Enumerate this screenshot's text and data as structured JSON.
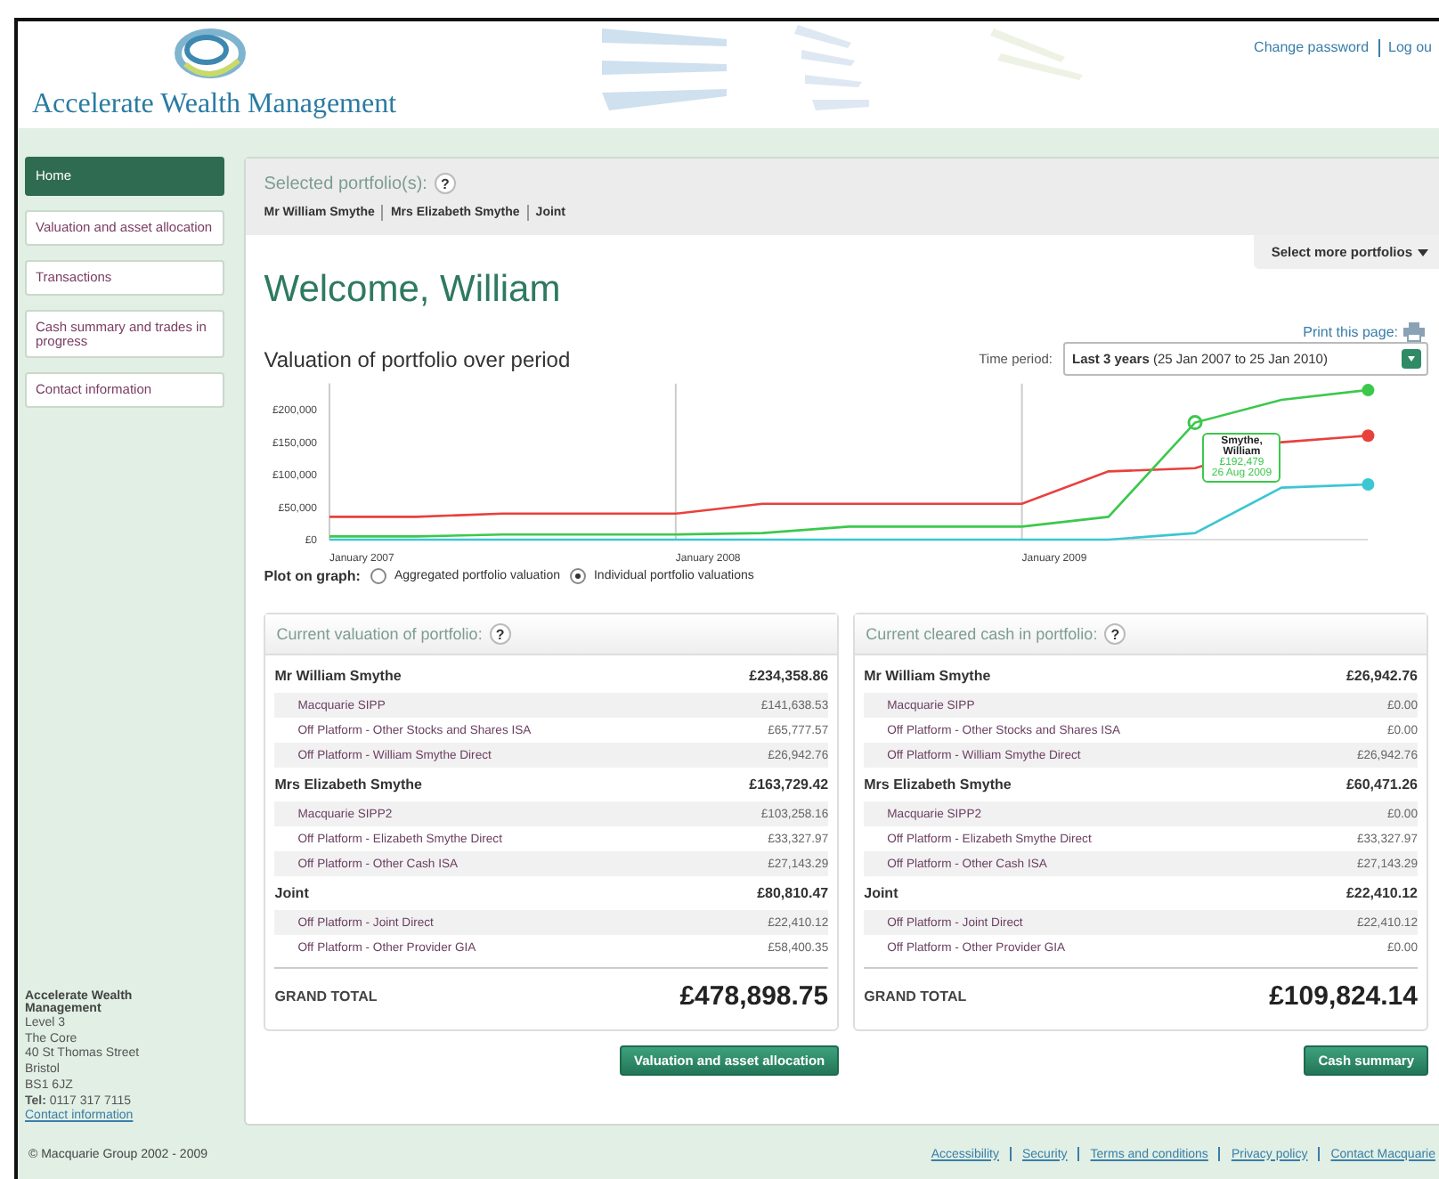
{
  "header": {
    "brand": "Accelerate Wealth Management",
    "links": [
      "Change password",
      "Log ou"
    ]
  },
  "sidebar": {
    "items": [
      {
        "label": "Home",
        "selected": true
      },
      {
        "label": "Valuation and asset allocation",
        "selected": false
      },
      {
        "label": "Transactions",
        "selected": false
      },
      {
        "label": "Cash summary and trades in progress",
        "selected": false
      },
      {
        "label": "Contact information",
        "selected": false
      }
    ],
    "address": {
      "name": "Accelerate Wealth Management",
      "lines": [
        "Level 3",
        "The Core",
        "40 St Thomas Street",
        "Bristol",
        "BS1 6JZ"
      ],
      "tel": "**Tel:** 0117 317 7115",
      "link": "Contact information"
    }
  },
  "selected_portfolios": {
    "label": "Selected portfolio(s):",
    "help": "?",
    "names": [
      "Mr William Smythe",
      "Mrs Elizabeth Smythe",
      "Joint"
    ]
  },
  "select_more_button": "Select more portfolios",
  "welcome": "Welcome, William",
  "print_link": "Print this page:",
  "valuation_chart": {
    "title": "Valuation of portfolio over period",
    "time_period": {
      "label": "Time period:",
      "value": "**Last 3 years** (25 Jan 2007 to 25 Jan 2010)"
    },
    "tooltip": {
      "name": "Smythe, William",
      "value": "£192,479",
      "date": "26 Aug 2009"
    },
    "chart_data": {
      "type": "line",
      "categories": [
        "January 2007",
        null,
        null,
        null,
        "January 2008",
        null,
        null,
        null,
        "January 2009",
        null,
        null,
        null,
        null
      ],
      "series": [
        {
          "color": "#e8413c",
          "values": [
            35000,
            35000,
            40000,
            40000,
            40000,
            55000,
            55000,
            55000,
            55000,
            105000,
            110000,
            150000,
            160000
          ]
        },
        {
          "color": "#3cc84c",
          "values": [
            5000,
            5000,
            8000,
            8000,
            8000,
            10000,
            20000,
            20000,
            20000,
            35000,
            180000,
            215000,
            230000
          ]
        },
        {
          "color": "#3cc6d2",
          "values": [
            0,
            0,
            0,
            0,
            0,
            0,
            0,
            0,
            0,
            0,
            10000,
            80000,
            85000
          ]
        }
      ],
      "ylim": [
        0,
        240000
      ],
      "yticks": [
        {
          "value": 0,
          "label": "£0"
        },
        {
          "value": 50000,
          "label": "£50,000"
        },
        {
          "value": 100000,
          "label": "£100,000"
        },
        {
          "value": 150000,
          "label": "£150,000"
        },
        {
          "value": 200000,
          "label": "£200,000"
        }
      ]
    },
    "plot_on_graph": {
      "label": "Plot on graph:",
      "options": [
        {
          "label": "Aggregated portfolio valuation",
          "selected": false
        },
        {
          "label": "Individual portfolio valuations",
          "selected": true
        }
      ]
    }
  },
  "cards": [
    {
      "title": "Current valuation of portfolio:",
      "help": "?",
      "groups": [
        {
          "name": "Mr William Smythe",
          "total": "£234,358.86",
          "items": [
            {
              "name": "Macquarie SIPP",
              "value": "£141,638.53"
            },
            {
              "name": "Off Platform - Other Stocks and Shares ISA",
              "value": "£65,777.57"
            },
            {
              "name": "Off Platform - William Smythe Direct",
              "value": "£26,942.76"
            }
          ]
        },
        {
          "name": "Mrs Elizabeth Smythe",
          "total": "£163,729.42",
          "items": [
            {
              "name": "Macquarie SIPP2",
              "value": "£103,258.16"
            },
            {
              "name": "Off Platform - Elizabeth Smythe Direct",
              "value": "£33,327.97"
            },
            {
              "name": "Off Platform - Other Cash ISA",
              "value": "£27,143.29"
            }
          ]
        },
        {
          "name": "Joint",
          "total": "£80,810.47",
          "items": [
            {
              "name": "Off Platform - Joint Direct",
              "value": "£22,410.12"
            },
            {
              "name": "Off Platform - Other Provider GIA",
              "value": "£58,400.35"
            }
          ]
        }
      ],
      "grand_total_label": "GRAND TOTAL",
      "grand_total": "£478,898.75",
      "button": "Valuation and asset allocation"
    },
    {
      "title": "Current cleared cash in portfolio:",
      "help": "?",
      "groups": [
        {
          "name": "Mr William Smythe",
          "total": "£26,942.76",
          "items": [
            {
              "name": "Macquarie SIPP",
              "value": "£0.00"
            },
            {
              "name": "Off Platform - Other Stocks and Shares ISA",
              "value": "£0.00"
            },
            {
              "name": "Off Platform - William Smythe Direct",
              "value": "£26,942.76"
            }
          ]
        },
        {
          "name": "Mrs Elizabeth Smythe",
          "total": "£60,471.26",
          "items": [
            {
              "name": "Macquarie SIPP2",
              "value": "£0.00"
            },
            {
              "name": "Off Platform - Elizabeth Smythe Direct",
              "value": "£33,327.97"
            },
            {
              "name": "Off Platform - Other Cash ISA",
              "value": "£27,143.29"
            }
          ]
        },
        {
          "name": "Joint",
          "total": "£22,410.12",
          "items": [
            {
              "name": "Off Platform - Joint Direct",
              "value": "£22,410.12"
            },
            {
              "name": "Off Platform - Other Provider GIA",
              "value": "£0.00"
            }
          ]
        }
      ],
      "grand_total_label": "GRAND TOTAL",
      "grand_total": "£109,824.14",
      "button": "Cash summary"
    }
  ],
  "footer": {
    "copyright": "© Macquarie Group 2002 - 2009",
    "links": [
      "Accessibility",
      "Security",
      "Terms and conditions",
      "Privacy policy",
      "Contact Macquarie"
    ]
  }
}
